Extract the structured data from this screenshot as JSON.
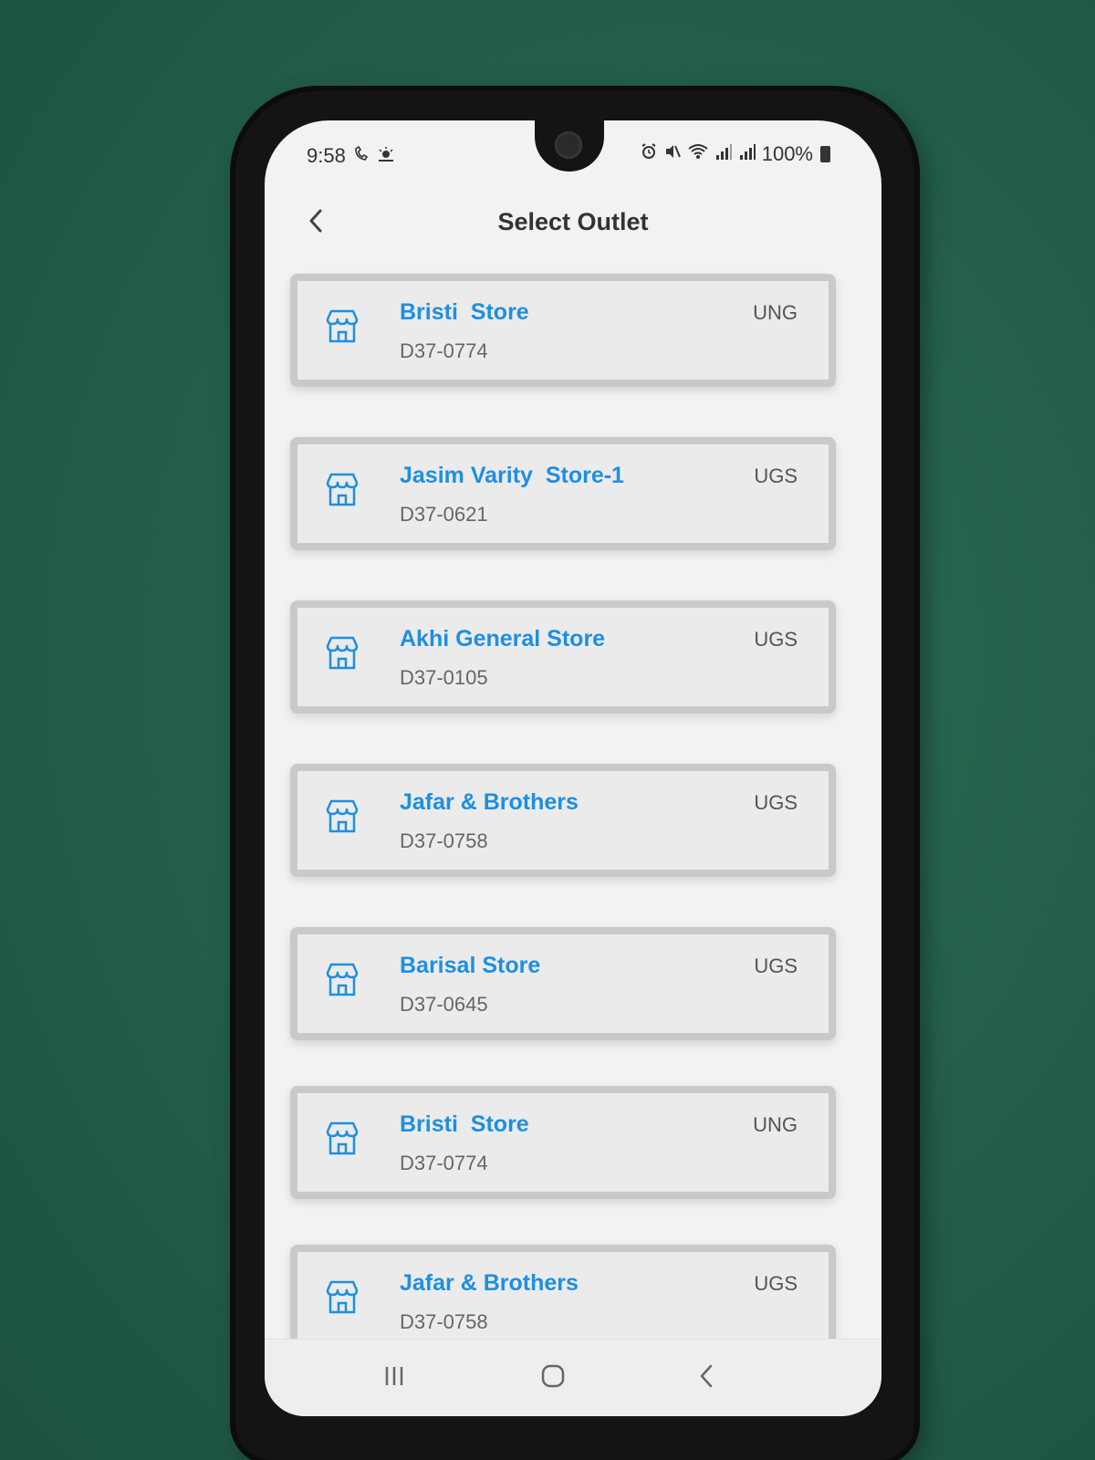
{
  "status_bar": {
    "time": "9:58",
    "left_icons": [
      "call-forwarding-icon",
      "weather-icon"
    ],
    "right_icons": [
      "alarm-icon",
      "mute-icon",
      "wifi-icon",
      "signal-1-icon",
      "signal-2-icon",
      "battery-icon"
    ],
    "battery": "100%"
  },
  "header": {
    "title": "Select Outlet",
    "back_icon": "chevron-left-icon"
  },
  "outlets": [
    {
      "name": "Bristi  Store",
      "code": "D37-0774",
      "type": "UNG",
      "icon": "store-icon"
    },
    {
      "name": "Jasim Varity  Store-1",
      "code": "D37-0621",
      "type": "UGS",
      "icon": "store-icon"
    },
    {
      "name": "Akhi General Store",
      "code": "D37-0105",
      "type": "UGS",
      "icon": "store-icon"
    },
    {
      "name": "Jafar & Brothers",
      "code": "D37-0758",
      "type": "UGS",
      "icon": "store-icon"
    },
    {
      "name": "Barisal Store",
      "code": "D37-0645",
      "type": "UGS",
      "icon": "store-icon"
    },
    {
      "name": "Bristi  Store",
      "code": "D37-0774",
      "type": "UNG",
      "icon": "store-icon"
    },
    {
      "name": "Jafar & Brothers",
      "code": "D37-0758",
      "type": "UGS",
      "icon": "store-icon"
    }
  ],
  "nav_bar": {
    "buttons": [
      "recents-icon",
      "home-icon",
      "back-icon"
    ]
  },
  "colors": {
    "accent": "#1e8fe0",
    "background": "#f2f2f2",
    "card": "#ebebeb",
    "card_border": "#c9c9c9"
  }
}
